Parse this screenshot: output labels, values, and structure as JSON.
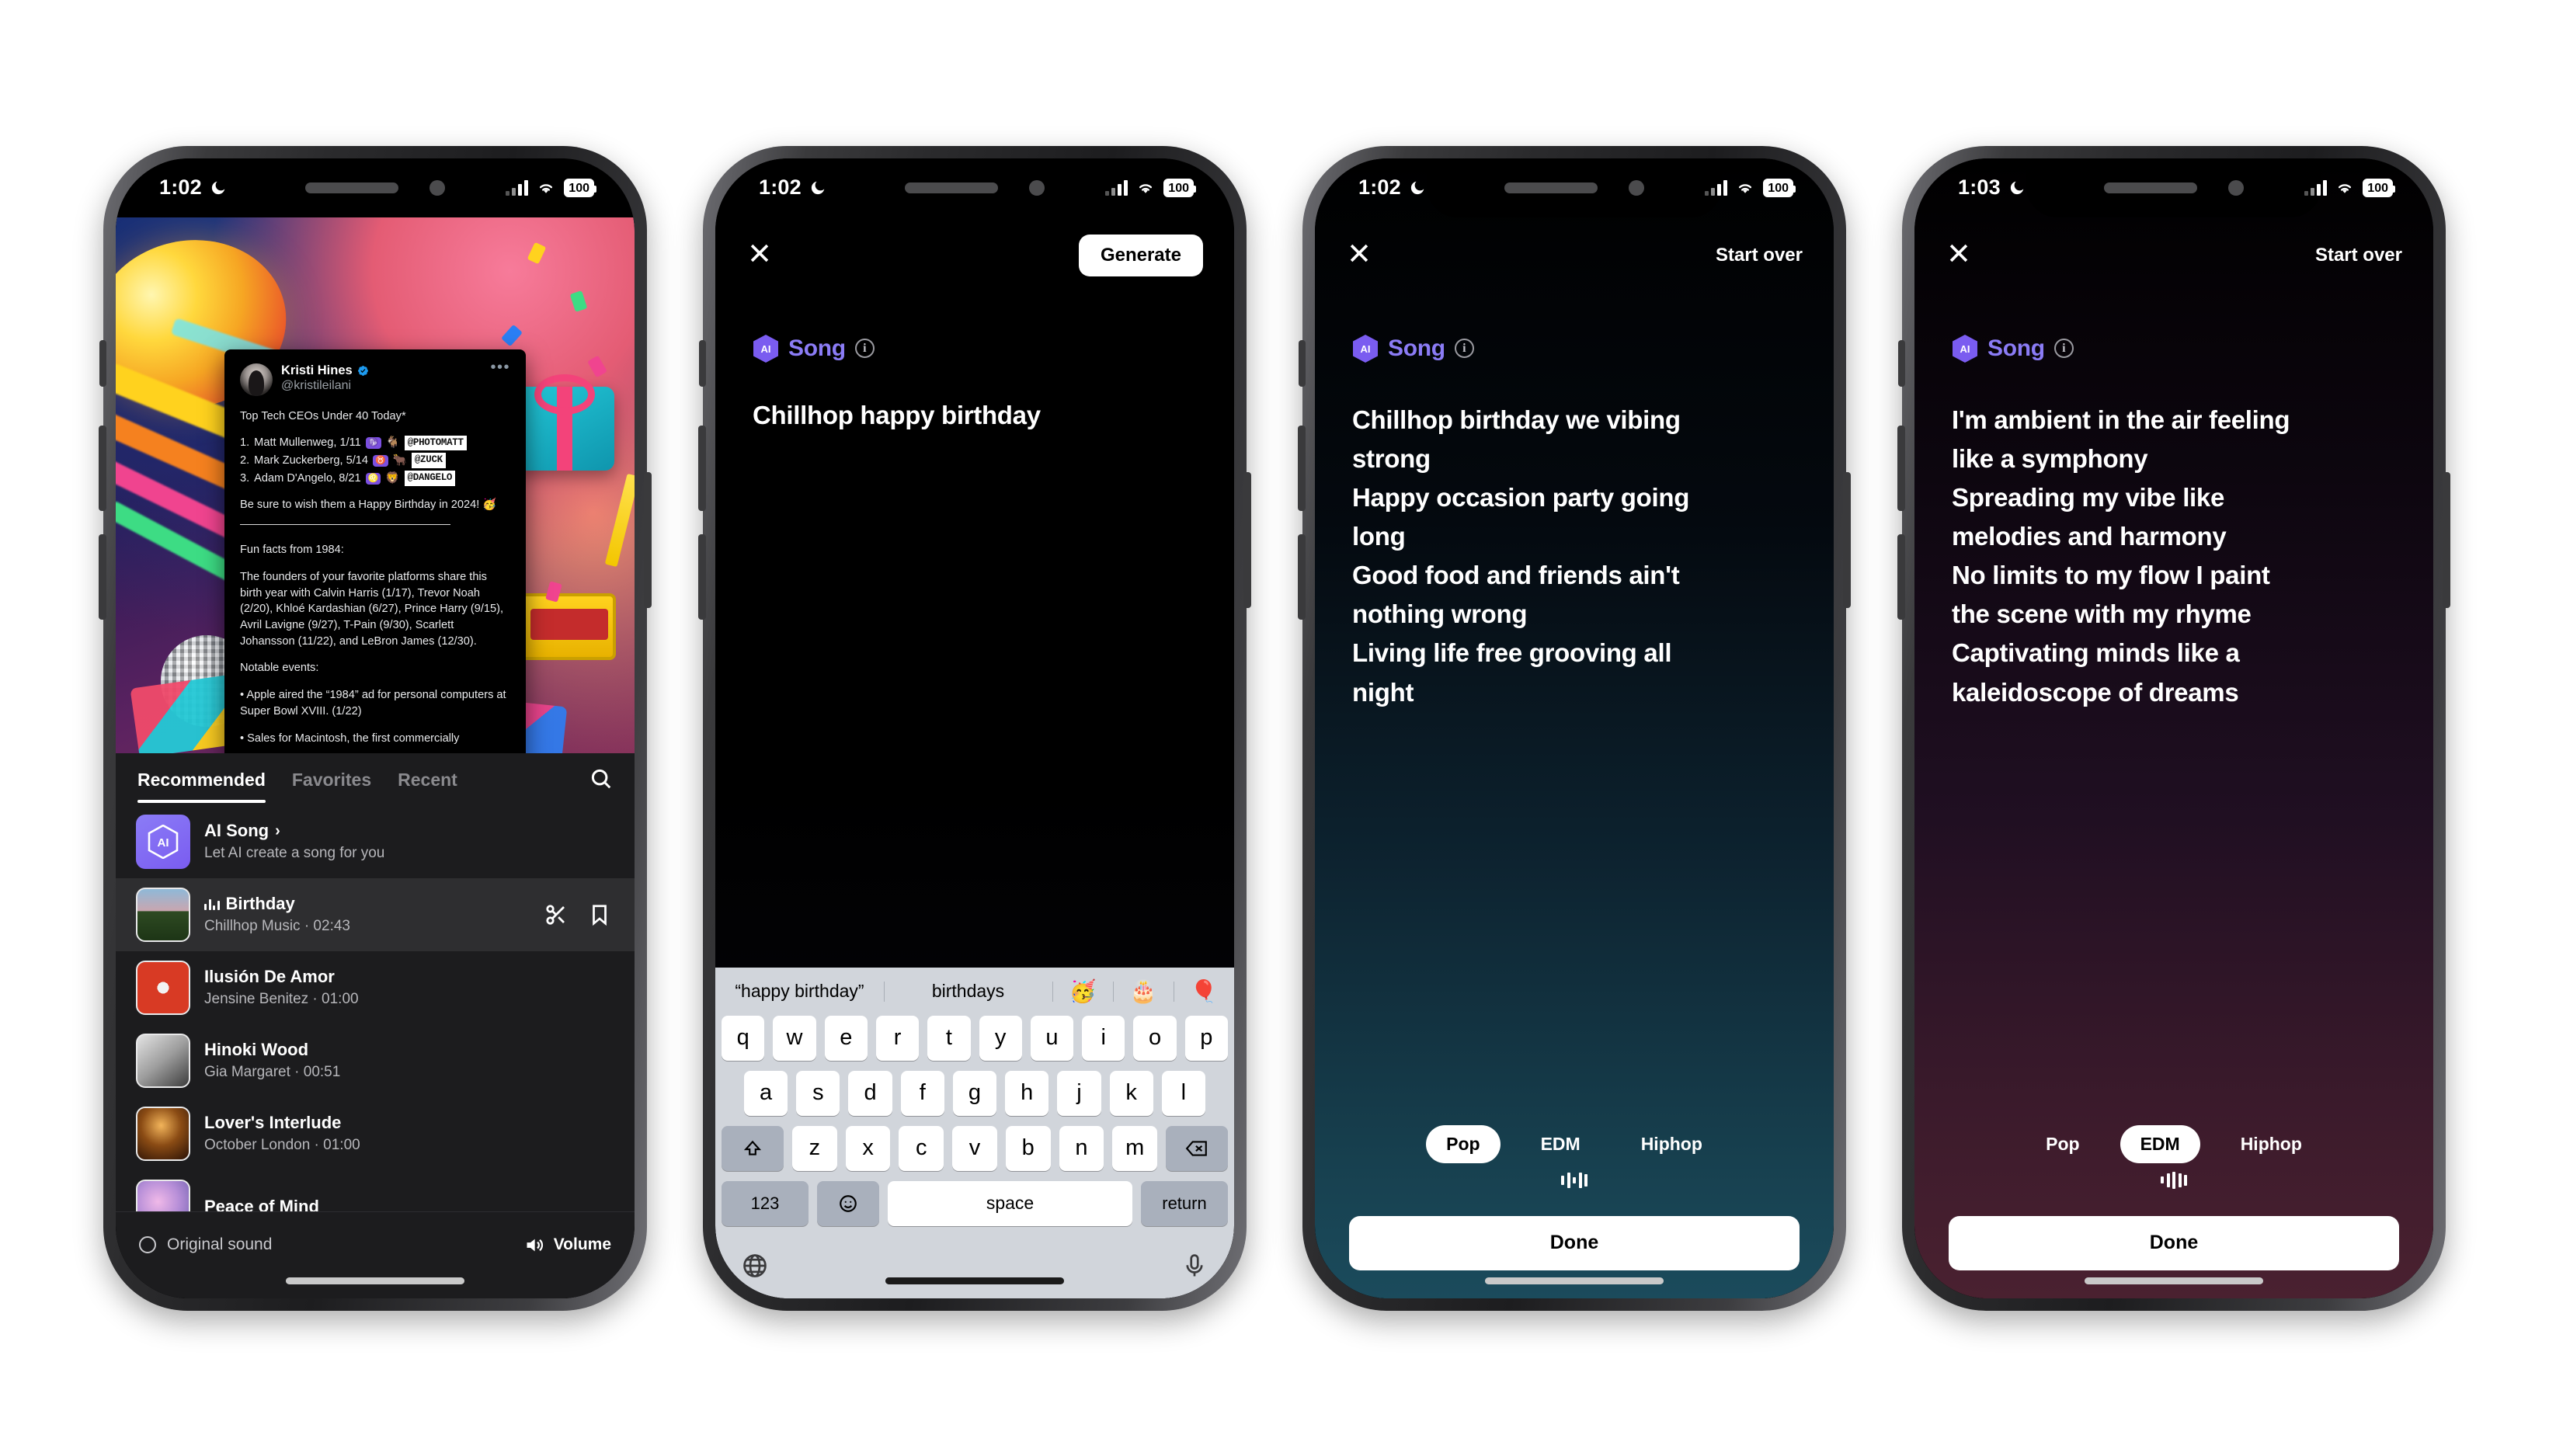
{
  "phones": [
    {
      "id": "phone-music-picker",
      "status": {
        "time": "1:02",
        "battery": "100",
        "moon_icon": "crescent-moon-icon",
        "wifi_icon": "wifi-icon",
        "signal_icon": "cellular-signal-icon"
      },
      "tweet": {
        "name": "Kristi Hines",
        "verified_icon": "verified-badge-icon",
        "handle": "@kristileilani",
        "more_icon": "more-options-icon",
        "headline": "Top Tech CEOs Under 40 Today*",
        "ceos": [
          {
            "rank": "1.",
            "name": "Matt Mullenweg, 1/11",
            "zodiac": "♑",
            "animal": "🐐",
            "handle": "@PHOTOMATT"
          },
          {
            "rank": "2.",
            "name": "Mark Zuckerberg, 5/14",
            "zodiac": "♉",
            "animal": "🐂",
            "handle": "@ZUCK"
          },
          {
            "rank": "3.",
            "name": "Adam D'Angelo, 8/21",
            "zodiac": "♌",
            "animal": "🦁",
            "handle": "@DANGELO"
          }
        ],
        "wish": "Be sure to wish them a Happy Birthday in 2024! 🥳",
        "fun_facts_title": "Fun facts from 1984:",
        "fun_facts_body": "The founders of your favorite platforms share this birth year with Calvin Harris (1/17), Trevor Noah (2/20), Khloé Kardashian (6/27), Prince Harry (9/15), Avril Lavigne (9/27), T-Pain (9/30), Scarlett Johansson (11/22), and LeBron James (12/30).",
        "notable_title": "Notable events:",
        "notable_1": "• Apple aired the “1984” ad for personal computers at Super Bowl XVIII. (1/22)",
        "notable_2": "• Sales for Macintosh, the first commercially"
      },
      "sheet": {
        "tabs": [
          {
            "label": "Recommended",
            "active": true
          },
          {
            "label": "Favorites",
            "active": false
          },
          {
            "label": "Recent",
            "active": false
          }
        ],
        "search_icon": "search-icon",
        "tracks": [
          {
            "title": "AI Song",
            "subtitle": "Let AI create a song for you",
            "kind": "ai",
            "chevron": "›"
          },
          {
            "title": "Birthday",
            "subtitle": "Chillhop Music · 02:43",
            "kind": "selected",
            "playing_icon": "equalizer-icon",
            "trim_icon": "scissors-icon",
            "save_icon": "bookmark-icon"
          },
          {
            "title": "Ilusión De Amor",
            "subtitle": "Jensine Benitez · 01:00",
            "kind": "normal"
          },
          {
            "title": "Hinoki Wood",
            "subtitle": "Gia Margaret · 00:51",
            "kind": "normal"
          },
          {
            "title": "Lover's Interlude",
            "subtitle": "October London · 01:00",
            "kind": "normal"
          },
          {
            "title": "Peace of Mind",
            "subtitle": "",
            "kind": "normal"
          }
        ],
        "original_sound": "Original sound",
        "volume": "Volume",
        "volume_icon": "speaker-volume-icon"
      }
    },
    {
      "id": "phone-ai-prompt",
      "status": {
        "time": "1:02",
        "battery": "100"
      },
      "close_icon": "close-icon",
      "action_label": "Generate",
      "ai_badge": {
        "label": "Song",
        "logo": "ai-hexagon-icon",
        "info_icon": "info-circle-icon"
      },
      "prompt": "Chillhop happy birthday",
      "keyboard": {
        "suggestions": [
          "“happy birthday”",
          "birthdays"
        ],
        "emoji_suggestions": [
          "🥳",
          "🎂",
          "🎈"
        ],
        "row1": [
          "q",
          "w",
          "e",
          "r",
          "t",
          "y",
          "u",
          "i",
          "o",
          "p"
        ],
        "row2": [
          "a",
          "s",
          "d",
          "f",
          "g",
          "h",
          "j",
          "k",
          "l"
        ],
        "row3": [
          "z",
          "x",
          "c",
          "v",
          "b",
          "n",
          "m"
        ],
        "shift_icon": "shift-key-icon",
        "backspace_icon": "backspace-key-icon",
        "numbers_key": "123",
        "emoji_key_icon": "emoji-key-icon",
        "space_key": "space",
        "return_key": "return",
        "globe_icon": "globe-key-icon",
        "mic_icon": "microphone-icon"
      }
    },
    {
      "id": "phone-ai-result-pop",
      "status": {
        "time": "1:02",
        "battery": "100"
      },
      "close_icon": "close-icon",
      "action_label": "Start over",
      "ai_badge": {
        "label": "Song",
        "logo": "ai-hexagon-icon",
        "info_icon": "info-circle-icon"
      },
      "lyrics": [
        "Chillhop birthday we vibing",
        "strong",
        "Happy occasion party going",
        "long",
        "Good food and friends ain't",
        "nothing wrong",
        "Living life free grooving all",
        "night"
      ],
      "genres": [
        {
          "label": "Pop",
          "active": true
        },
        {
          "label": "EDM",
          "active": false
        },
        {
          "label": "Hiphop",
          "active": false
        }
      ],
      "waveform_icon": "audio-waveform-icon",
      "waveform_heights": [
        12,
        20,
        8,
        20,
        16
      ],
      "done_label": "Done"
    },
    {
      "id": "phone-ai-result-edm",
      "status": {
        "time": "1:03",
        "battery": "100"
      },
      "close_icon": "close-icon",
      "action_label": "Start over",
      "ai_badge": {
        "label": "Song",
        "logo": "ai-hexagon-icon",
        "info_icon": "info-circle-icon"
      },
      "lyrics": [
        "I'm ambient in the air feeling",
        "like a symphony",
        "Spreading my vibe like",
        "melodies and harmony",
        "No limits to my flow I paint",
        "the scene with my rhyme",
        "Captivating minds like a",
        "kaleidoscope of dreams"
      ],
      "genres": [
        {
          "label": "Pop",
          "active": false
        },
        {
          "label": "EDM",
          "active": true
        },
        {
          "label": "Hiphop",
          "active": false
        }
      ],
      "waveform_icon": "audio-waveform-icon",
      "waveform_heights": [
        9,
        18,
        22,
        18,
        14
      ],
      "done_label": "Done"
    }
  ],
  "colors": {
    "accent_purple": "#8b7cf6",
    "keyboard_bg": "#d1d5db",
    "sheet_bg": "#1c1c1e",
    "selected_row": "#2e2e30",
    "verified_blue": "#1d9bf0"
  }
}
